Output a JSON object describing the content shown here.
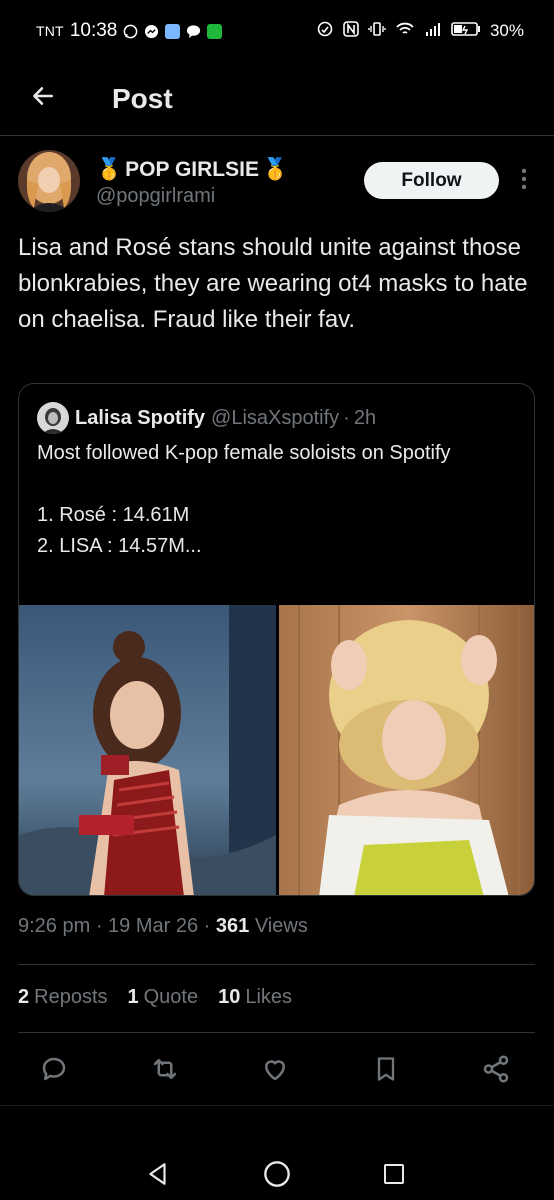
{
  "status_bar": {
    "carrier": "TNT",
    "time": "10:38",
    "battery": "30%",
    "app_colors": [
      "#7ab7ff",
      "#1fb83a"
    ],
    "icons": [
      "whatsapp-icon",
      "messenger-icon",
      "app-icon",
      "chat-icon",
      "green-app-icon",
      "signal-icon",
      "nfc-icon",
      "vibrate-icon",
      "wifi-icon",
      "cell-signal-icon",
      "battery-icon"
    ]
  },
  "header": {
    "title": "Post",
    "back_icon": "arrow-left-icon"
  },
  "post": {
    "author_name": "POP GIRLSIE",
    "author_badge": "🥇",
    "author_handle": "@popgirlrami",
    "follow_label": "Follow",
    "text": "Lisa and Rosé stans should unite against those blonkrabies, they are wearing ot4 masks to hate on chaelisa. Fraud like their fav.",
    "timestamp": "9:26 pm",
    "date": "19 Mar 26",
    "views_count": "361",
    "views_label": "Views"
  },
  "quote": {
    "name": "Lalisa Spotify",
    "handle": "@LisaXspotify",
    "time": "2h",
    "text": "Most followed K-pop female soloists on Spotify\n\n1. Rosé : 14.61M\n2. LISA : 14.57M..."
  },
  "stats": {
    "reposts_count": "2",
    "reposts_label": "Reposts",
    "quotes_count": "1",
    "quotes_label": "Quote",
    "likes_count": "10",
    "likes_label": "Likes"
  },
  "colors": {
    "background": "#000000",
    "text": "#e7e9ea",
    "muted": "#71767b",
    "border": "#2f3336",
    "follow_bg": "#eff3f4"
  }
}
